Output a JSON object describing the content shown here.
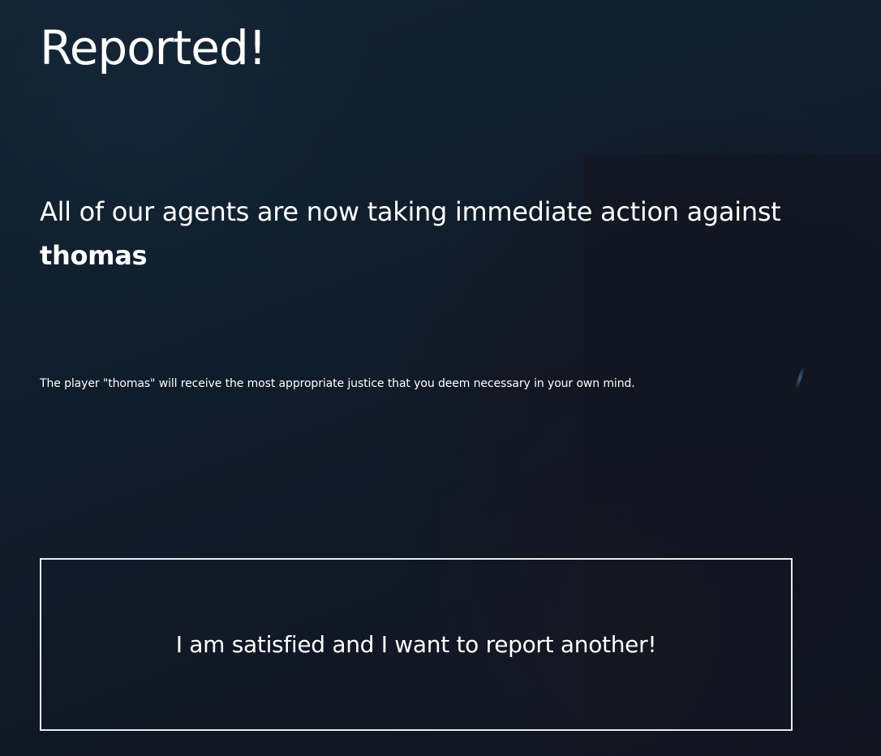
{
  "page": {
    "title": "Reported!",
    "message_prefix": "All of our agents are now taking immediate action against",
    "player_name": "thomas",
    "detail": "The player \"thomas\" will receive the most appropriate justice that you deem necessary in your own mind.",
    "report_another_label": "I am satisfied and I want to report another!"
  },
  "colors": {
    "background": "#0f1a27",
    "text": "#ffffff",
    "button_border": "#e8ecef"
  }
}
